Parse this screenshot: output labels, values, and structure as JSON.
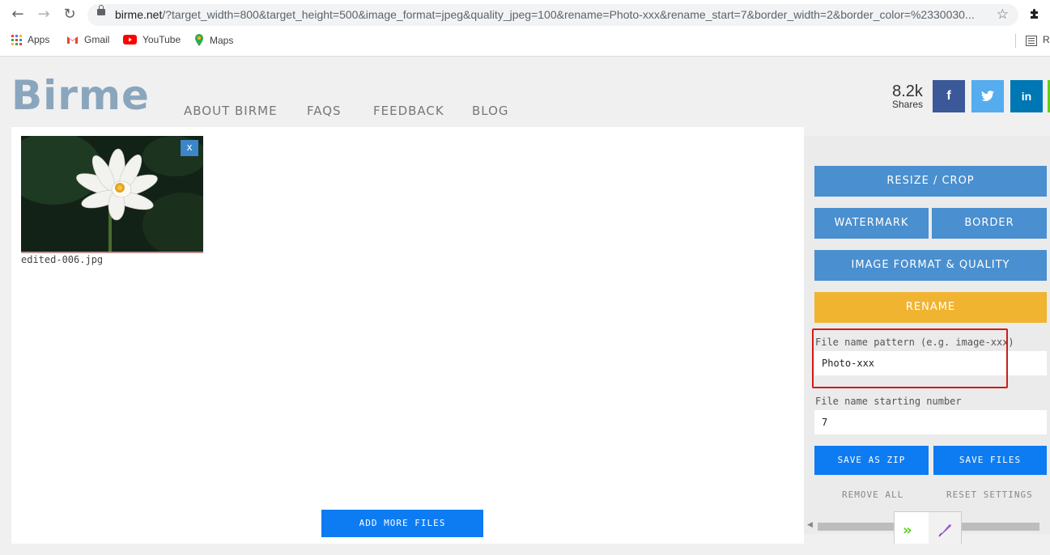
{
  "browser": {
    "url_host": "birme.net",
    "url_rest": "/?target_width=800&target_height=500&image_format=jpeg&quality_jpeg=100&rename=Photo-xxx&rename_start=7&border_width=2&border_color=%2330030...",
    "bookmarks": [
      {
        "label": "Apps",
        "icon": "apps-grid-icon"
      },
      {
        "label": "Gmail",
        "icon": "gmail-icon"
      },
      {
        "label": "YouTube",
        "icon": "youtube-icon"
      },
      {
        "label": "Maps",
        "icon": "maps-icon"
      }
    ],
    "bookmark_overflow": "R"
  },
  "site": {
    "logo": "Birme",
    "menu": [
      "ABOUT BIRME",
      "FAQS",
      "FEEDBACK",
      "BLOG"
    ],
    "shares_count": "8.2k",
    "shares_label": "Shares",
    "social": [
      {
        "label": "f",
        "icon": "facebook-icon",
        "color": "#3b5998"
      },
      {
        "label": "",
        "icon": "twitter-icon",
        "color": "#55acee"
      },
      {
        "label": "in",
        "icon": "linkedin-icon",
        "color": "#0077b5"
      }
    ]
  },
  "gallery": {
    "files": [
      {
        "name": "edited-006.jpg",
        "close": "x"
      }
    ],
    "add_more": "ADD MORE FILES"
  },
  "sidebar": {
    "resize": "RESIZE / CROP",
    "watermark": "WATERMARK",
    "border": "BORDER",
    "format": "IMAGE FORMAT & QUALITY",
    "rename": "RENAME",
    "pattern_label": "File name pattern (e.g. image-xxx)",
    "pattern_value": "Photo-xxx",
    "start_label": "File name starting number",
    "start_value": "7",
    "save_zip": "SAVE AS ZIP",
    "save_files": "SAVE FILES",
    "remove_all": "REMOVE ALL",
    "reset": "RESET SETTINGS"
  },
  "colors": {
    "accent_blue": "#0d7cf2",
    "panel_blue": "#4a8fcf",
    "rename_orange": "#f0b430",
    "highlight_red": "#d21b1b"
  }
}
